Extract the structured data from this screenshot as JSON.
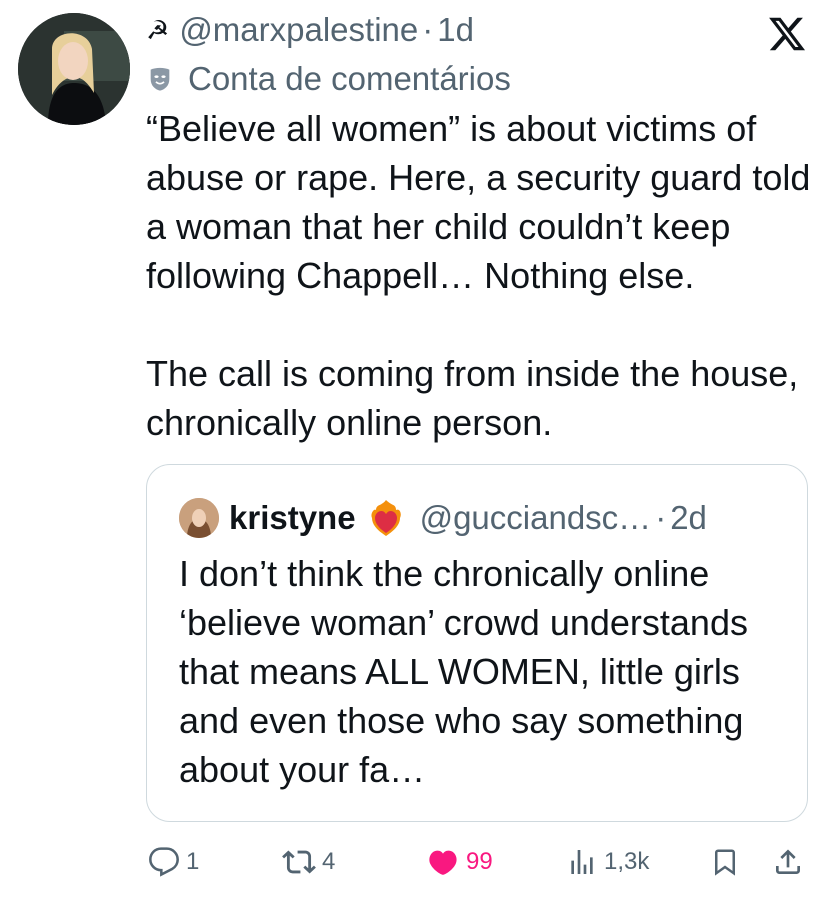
{
  "author": {
    "handle": "@marxpalestine",
    "separator": "·",
    "time": "1d",
    "account_label": "Conta de comentários",
    "badge_icon": "hammer-and-sickle-icon"
  },
  "tweet": {
    "paragraph1": "“Believe all women” is about victims of abuse or rape. Here, a security guard told a woman that her child couldn’t keep following Chappell… Nothing else.",
    "paragraph2": "The call is coming from inside the house, chronically online person."
  },
  "quote": {
    "name": "kristyne",
    "emoji_icon": "heart-on-fire-icon",
    "handle": "@gucciandsc…",
    "separator": "·",
    "time": "2d",
    "text": "I don’t think the chronically online ‘believe woman’ crowd understands that means ALL WOMEN, little girls and even those who say something about your fa…"
  },
  "actions": {
    "replies": "1",
    "reposts": "4",
    "likes": "99",
    "views": "1,3k"
  },
  "colors": {
    "text": "#0f1419",
    "secondary": "#536471",
    "like": "#f91880",
    "border": "#cfd9de"
  }
}
